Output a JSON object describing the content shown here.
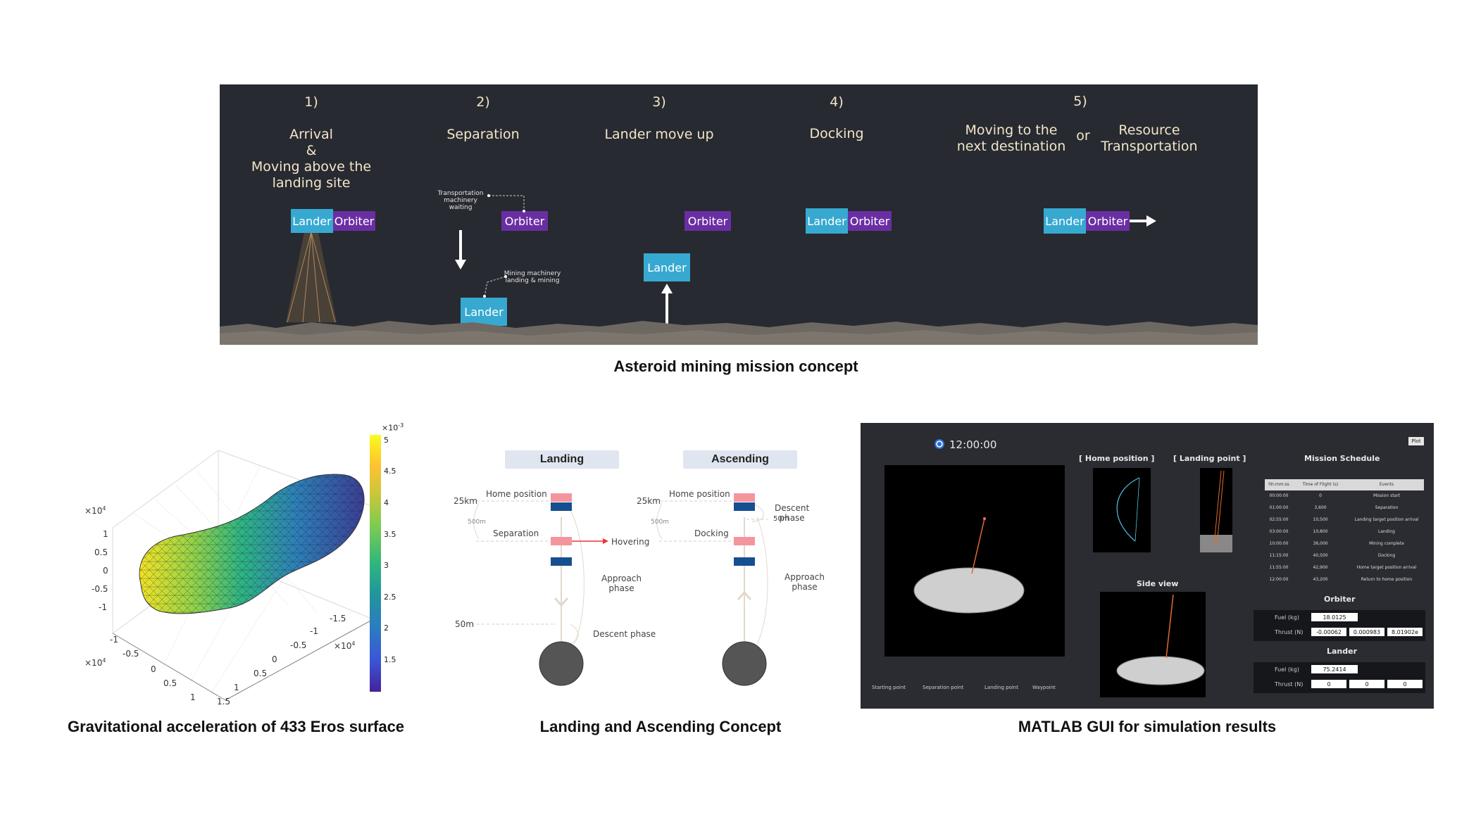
{
  "concept": {
    "steps": [
      {
        "num": "1)",
        "title": "Arrival\n&\nMoving above the\nlanding site"
      },
      {
        "num": "2)",
        "title": "Separation"
      },
      {
        "num": "3)",
        "title": "Lander move up"
      },
      {
        "num": "4)",
        "title": "Docking"
      },
      {
        "num": "5)",
        "title": "Moving to the\nnext destination"
      }
    ],
    "or_label": "or",
    "step5_alt": "Resource\nTransportation",
    "lander_label": "Lander",
    "orbiter_label": "Orbiter",
    "note_transport": "Transportation\nmachinery waiting",
    "note_mining": "Mining machinery\nlanding & mining",
    "caption": "Asteroid mining mission concept"
  },
  "eros": {
    "caption": "Gravitational  acceleration  of 433 Eros surface",
    "z_exp": "×10",
    "z_exp_power": "4",
    "z_ticks": [
      "1",
      "0.5",
      "0",
      "-0.5",
      "-1"
    ],
    "x_ticks": [
      "-1",
      "-0.5",
      "0",
      "0.5",
      "1"
    ],
    "x_exp_power": "4",
    "y_ticks": [
      "-1.5",
      "-1",
      "-0.5",
      "0",
      "0.5",
      "1",
      "1.5"
    ],
    "y_exp_power": "4",
    "colorbar_exp": "×10",
    "colorbar_exp_power": "-3",
    "colorbar_ticks": [
      "5",
      "4.5",
      "4",
      "3.5",
      "3",
      "2.5",
      "2",
      "1.5"
    ]
  },
  "landing": {
    "caption": "Landing and Ascending Concept",
    "landing_title": "Landing",
    "ascending_title": "Ascending",
    "l_25km": "25km",
    "l_home": "Home position",
    "l_500m": "500m",
    "l_separation": "Separation",
    "l_hovering": "Hovering",
    "l_approach": "Approach\nphase",
    "l_50m": "50m",
    "l_descent": "Descent phase",
    "r_25km": "25km",
    "r_home": "Home position",
    "r_500m": "500m",
    "r_docking": "Docking",
    "r_50m": "50m",
    "r_descent": "Descent\nphase",
    "r_approach": "Approach\nphase"
  },
  "gui": {
    "caption": "MATLAB GUI for simulation results",
    "clock": "12:00:00",
    "plot_button": "Plot",
    "home_title": "[ Home position ]",
    "landing_title": "[ Landing point ]",
    "side_title": "Side view",
    "schedule_title": "Mission Schedule",
    "schedule_headers": [
      "hh:mm:ss",
      "Time of Flight (s)",
      "Events"
    ],
    "schedule_rows": [
      [
        "00:00:00",
        "0",
        "Mission start"
      ],
      [
        "01:00:00",
        "3,600",
        "Separation"
      ],
      [
        "02:55:00",
        "10,500",
        "Landing target position arrival"
      ],
      [
        "03:00:00",
        "10,800",
        "Landing"
      ],
      [
        "10:00:00",
        "36,000",
        "Mining complete"
      ],
      [
        "11:15:00",
        "40,500",
        "Docking"
      ],
      [
        "11:55:00",
        "42,900",
        "Home target position arrival"
      ],
      [
        "12:00:00",
        "43,200",
        "Return to home position"
      ]
    ],
    "orbiter_title": "Orbiter",
    "lander_title": "Lander",
    "fuel_label": "Fuel (kg)",
    "thrust_label": "Thrust (N)",
    "orbiter_fuel": "18.0125",
    "orbiter_thrust": [
      "-0.00062",
      "0.000983",
      "8.01902e"
    ],
    "lander_fuel": "75.2414",
    "lander_thrust": [
      "0",
      "0",
      "0"
    ],
    "legend": [
      "Starting point",
      "Separation point",
      "Landing point",
      "Waypoint"
    ]
  }
}
